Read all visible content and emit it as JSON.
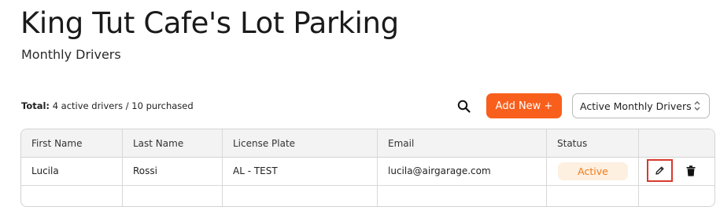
{
  "header": {
    "title": "King Tut Cafe's Lot Parking",
    "subtitle": "Monthly Drivers"
  },
  "toolbar": {
    "total_label": "Total:",
    "total_value": "4 active drivers / 10 purchased",
    "search_icon": "search-icon",
    "add_new_label": "Add New +",
    "filter_value": "Active Monthly Drivers",
    "accent_color": "#f85f1c"
  },
  "table": {
    "columns": [
      "First Name",
      "Last Name",
      "License Plate",
      "Email",
      "Status",
      ""
    ],
    "rows": [
      {
        "first_name": "Lucila",
        "last_name": "Rossi",
        "license_plate": "AL - TEST",
        "email": "lucila@airgarage.com",
        "status": "Active",
        "actions": [
          "edit-icon",
          "trash-icon"
        ]
      }
    ]
  }
}
